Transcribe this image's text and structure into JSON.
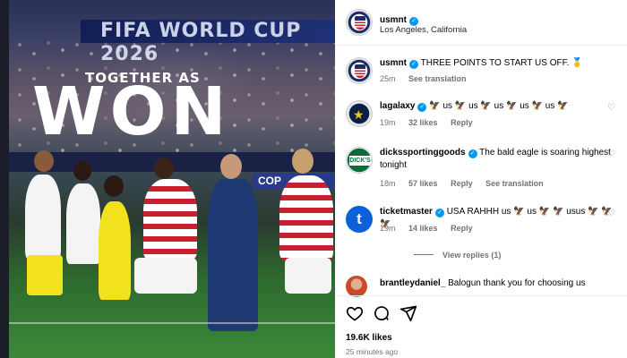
{
  "media": {
    "banner_text": "FIFA WORLD CUP 2026",
    "headline_small": "TOGETHER AS",
    "headline_large": "WON",
    "ad_text": "COP"
  },
  "post_header": {
    "username": "usmnt",
    "location": "Los Angeles, California"
  },
  "comments": [
    {
      "username": "usmnt",
      "text": "THREE POINTS TO START US OFF. 🥇",
      "time": "25m",
      "likes": "",
      "reply": "",
      "translate": "See translation",
      "avatar": "usmnt-avatar"
    },
    {
      "username": "lagalaxy",
      "text": "🦅 us 🦅 us 🦅 us 🦅 us 🦅 us 🦅",
      "time": "19m",
      "likes": "32 likes",
      "reply": "Reply",
      "translate": "",
      "avatar": "lagalaxy-avatar"
    },
    {
      "username": "dickssportinggoods",
      "text": "The bald eagle is soaring highest tonight",
      "time": "18m",
      "likes": "57 likes",
      "reply": "Reply",
      "translate": "See translation",
      "avatar": "dicks-avatar"
    },
    {
      "username": "ticketmaster",
      "text": "USA RAHHH us 🦅 us 🦅 🦅 usus 🦅 🦅 🦅",
      "time": "19m",
      "likes": "14 likes",
      "reply": "Reply",
      "translate": "",
      "avatar": "ticketmaster-avatar"
    },
    {
      "username": "brantleydaniel_",
      "text": "Balogun thank you for choosing us",
      "time": "",
      "likes": "",
      "reply": "",
      "translate": "",
      "avatar": "brantley-avatar"
    }
  ],
  "view_replies": "View replies (1)",
  "actions": {
    "like_icon": "heart-icon",
    "comment_icon": "comment-icon",
    "share_icon": "share-icon"
  },
  "likes_count": "19.6K likes",
  "post_time": "25 minutes ago",
  "colors": {
    "verified": "#0095f6",
    "secondary_text": "#737373"
  }
}
